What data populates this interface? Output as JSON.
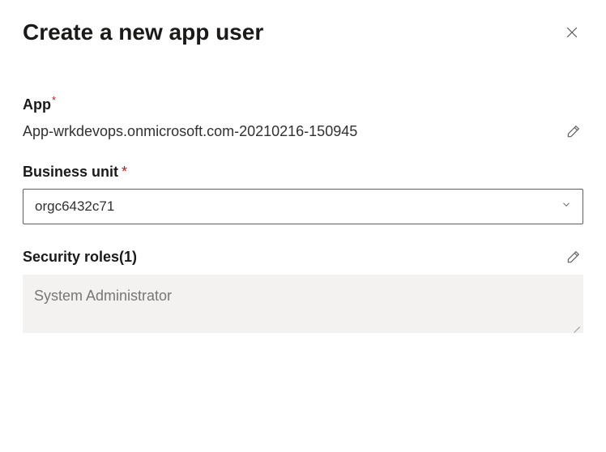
{
  "header": {
    "title": "Create a new app user"
  },
  "app": {
    "label": "App",
    "value": "App-wrkdevops.onmicrosoft.com-20210216-150945"
  },
  "business_unit": {
    "label": "Business unit",
    "selected": "orgc6432c71"
  },
  "security_roles": {
    "label": "Security roles(1)",
    "value": "System Administrator"
  }
}
